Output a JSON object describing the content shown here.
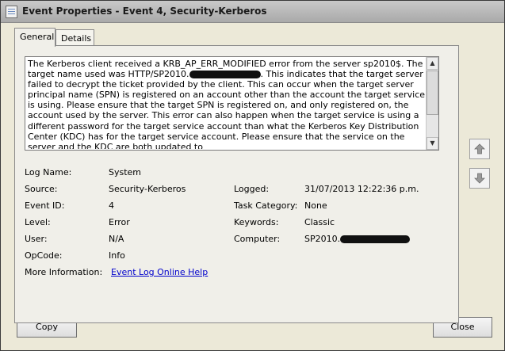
{
  "window": {
    "title": "Event Properties - Event 4, Security-Kerberos"
  },
  "tabs": [
    {
      "label": "General",
      "active": true
    },
    {
      "label": "Details",
      "active": false
    }
  ],
  "description": {
    "text_part1": "The Kerberos client received a KRB_AP_ERR_MODIFIED error from the server sp2010$. The target name used was HTTP/SP2010.",
    "text_part2": ". This indicates that the target server failed to decrypt the ticket provided by the client. This can occur when the target server principal name (SPN) is registered on an account other than the account the target service is using. Please ensure that the target SPN is registered on, and only registered on, the account used by the server. This error can also happen when the target service is using a different password for the target service account than what the Kerberos Key Distribution Center (KDC) has for the target service account. Please ensure that the service on the server and the KDC are both updated to"
  },
  "properties": {
    "log_name_label": "Log Name:",
    "log_name_value": "System",
    "source_label": "Source:",
    "source_value": "Security-Kerberos",
    "logged_label": "Logged:",
    "logged_value": "31/07/2013 12:22:36 p.m.",
    "event_id_label": "Event ID:",
    "event_id_value": "4",
    "task_category_label": "Task Category:",
    "task_category_value": "None",
    "level_label": "Level:",
    "level_value": "Error",
    "keywords_label": "Keywords:",
    "keywords_value": "Classic",
    "user_label": "User:",
    "user_value": "N/A",
    "computer_label": "Computer:",
    "computer_value": "SP2010.",
    "opcode_label": "OpCode:",
    "opcode_value": "Info",
    "more_info_label": "More Information:",
    "more_info_link": "Event Log Online Help"
  },
  "buttons": {
    "copy": "Copy",
    "close": "Close"
  },
  "icons": {
    "previous": "up-arrow-icon",
    "next": "down-arrow-icon"
  }
}
